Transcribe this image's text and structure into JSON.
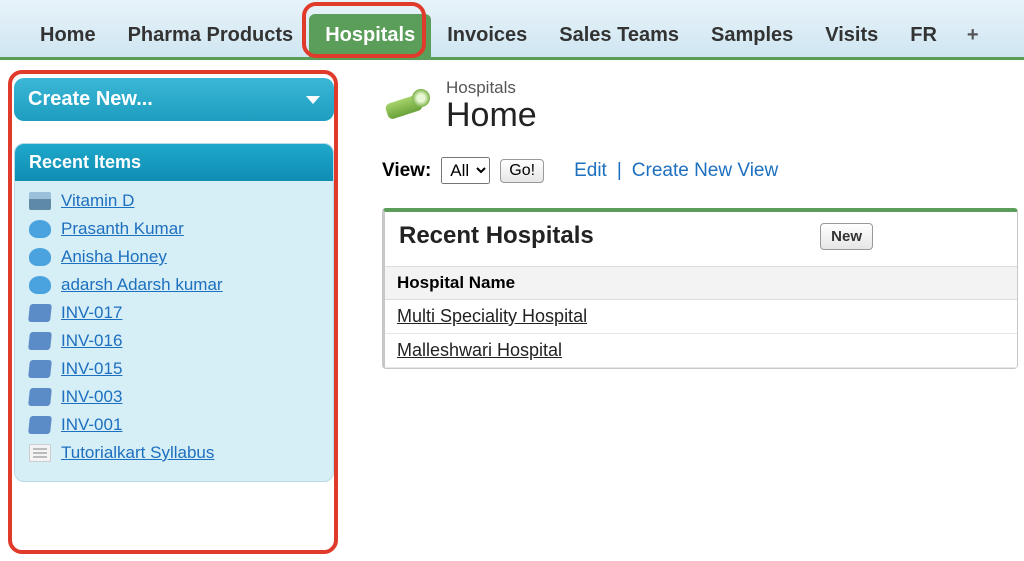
{
  "tabs": [
    {
      "label": "Home"
    },
    {
      "label": "Pharma Products"
    },
    {
      "label": "Hospitals"
    },
    {
      "label": "Invoices"
    },
    {
      "label": "Sales Teams"
    },
    {
      "label": "Samples"
    },
    {
      "label": "Visits"
    },
    {
      "label": "FR"
    }
  ],
  "active_tab_index": 2,
  "sidebar": {
    "create_new_label": "Create New...",
    "recent_header": "Recent Items",
    "items": [
      {
        "label": "Vitamin D",
        "icon": "prod"
      },
      {
        "label": "Prasanth Kumar",
        "icon": "user"
      },
      {
        "label": "Anisha Honey",
        "icon": "user"
      },
      {
        "label": "adarsh Adarsh kumar",
        "icon": "user"
      },
      {
        "label": "INV-017",
        "icon": "inv"
      },
      {
        "label": "INV-016",
        "icon": "inv"
      },
      {
        "label": "INV-015",
        "icon": "inv"
      },
      {
        "label": "INV-003",
        "icon": "inv"
      },
      {
        "label": "INV-001",
        "icon": "inv"
      },
      {
        "label": "Tutorialkart Syllabus",
        "icon": "doc"
      }
    ]
  },
  "main": {
    "breadcrumb": "Hospitals",
    "title": "Home",
    "view_label": "View:",
    "view_selected": "All",
    "go_label": "Go!",
    "edit_label": "Edit",
    "create_view_label": "Create New View",
    "panel_title": "Recent Hospitals",
    "new_label": "New",
    "column_header": "Hospital Name",
    "rows": [
      {
        "name": "Multi Speciality Hospital"
      },
      {
        "name": "Malleshwari Hospital"
      }
    ]
  }
}
